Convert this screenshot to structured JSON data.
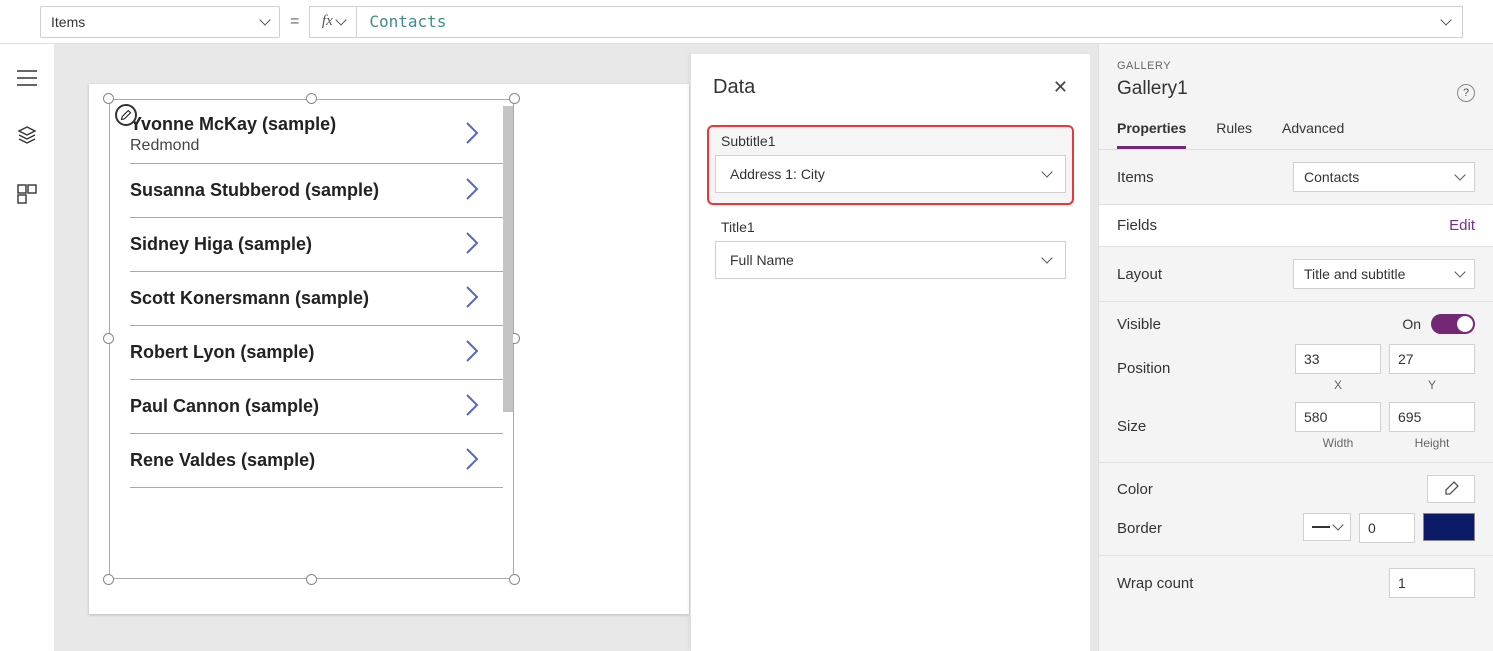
{
  "formula": {
    "property": "Items",
    "expression": "Contacts"
  },
  "gallery": {
    "items": [
      {
        "title": "Yvonne McKay (sample)",
        "subtitle": "Redmond"
      },
      {
        "title": "Susanna Stubberod (sample)",
        "subtitle": ""
      },
      {
        "title": "Sidney Higa (sample)",
        "subtitle": ""
      },
      {
        "title": "Scott Konersmann (sample)",
        "subtitle": ""
      },
      {
        "title": "Robert Lyon (sample)",
        "subtitle": ""
      },
      {
        "title": "Paul Cannon (sample)",
        "subtitle": ""
      },
      {
        "title": "Rene Valdes (sample)",
        "subtitle": ""
      }
    ]
  },
  "dataPane": {
    "heading": "Data",
    "subtitle_label": "Subtitle1",
    "subtitle_value": "Address 1: City",
    "title_label": "Title1",
    "title_value": "Full Name"
  },
  "props": {
    "category": "GALLERY",
    "name": "Gallery1",
    "tabs": {
      "properties": "Properties",
      "rules": "Rules",
      "advanced": "Advanced"
    },
    "items_label": "Items",
    "items_value": "Contacts",
    "fields_label": "Fields",
    "fields_link": "Edit",
    "layout_label": "Layout",
    "layout_value": "Title and subtitle",
    "visible_label": "Visible",
    "visible_value": "On",
    "position_label": "Position",
    "pos_x": "33",
    "pos_y": "27",
    "pos_x_lbl": "X",
    "pos_y_lbl": "Y",
    "size_label": "Size",
    "size_w": "580",
    "size_h": "695",
    "size_w_lbl": "Width",
    "size_h_lbl": "Height",
    "color_label": "Color",
    "border_label": "Border",
    "border_width": "0",
    "wrap_label": "Wrap count",
    "wrap_value": "1"
  }
}
